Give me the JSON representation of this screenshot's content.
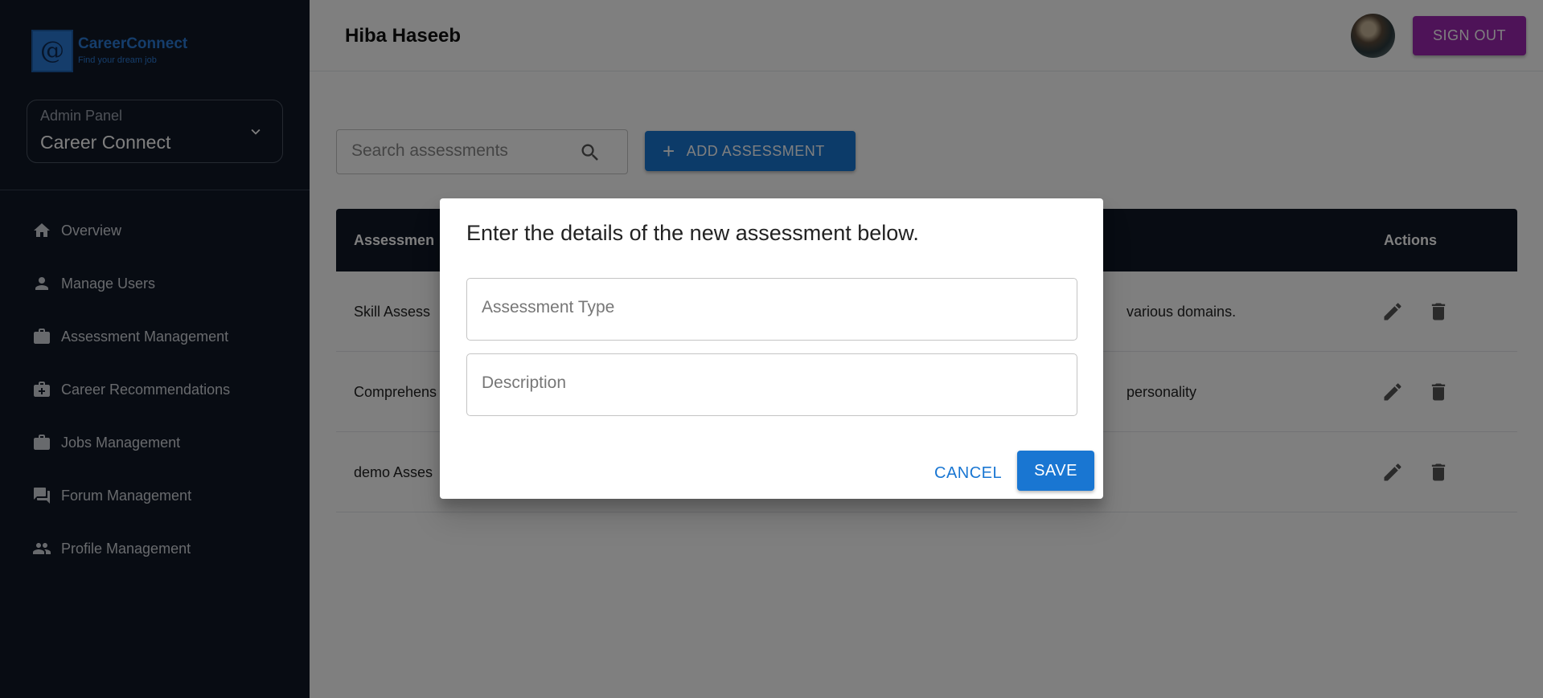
{
  "logo": {
    "mark": "@",
    "name": "CareerConnect",
    "tagline": "Find your dream job"
  },
  "sidebar": {
    "panel_label": "Admin Panel",
    "panel_value": "Career Connect",
    "items": [
      {
        "label": "Overview",
        "icon": "home-icon"
      },
      {
        "label": "Manage Users",
        "icon": "person-icon"
      },
      {
        "label": "Assessment Management",
        "icon": "briefcase-icon"
      },
      {
        "label": "Career Recommendations",
        "icon": "medical-bag-icon"
      },
      {
        "label": "Jobs Management",
        "icon": "briefcase-icon"
      },
      {
        "label": "Forum Management",
        "icon": "forum-icon"
      },
      {
        "label": "Profile Management",
        "icon": "people-icon"
      }
    ]
  },
  "header": {
    "user_name": "Hiba Haseeb",
    "signout_label": "SIGN OUT"
  },
  "toolbar": {
    "search_placeholder": "Search assessments",
    "add_label": "ADD ASSESSMENT"
  },
  "table": {
    "header_name": "Assessmen",
    "header_actions": "Actions",
    "rows": [
      {
        "name": "Skill Assess",
        "desc": "various domains."
      },
      {
        "name": "Comprehens",
        "desc": "personality"
      },
      {
        "name": "demo Asses",
        "desc": ""
      }
    ]
  },
  "dialog": {
    "title": "Enter the details of the new assessment below.",
    "type_placeholder": "Assessment Type",
    "desc_placeholder": "Description",
    "cancel_label": "CANCEL",
    "save_label": "SAVE"
  },
  "colors": {
    "sidebar_bg": "#111827",
    "primary": "#1976d2",
    "signout": "#9c27b0"
  }
}
